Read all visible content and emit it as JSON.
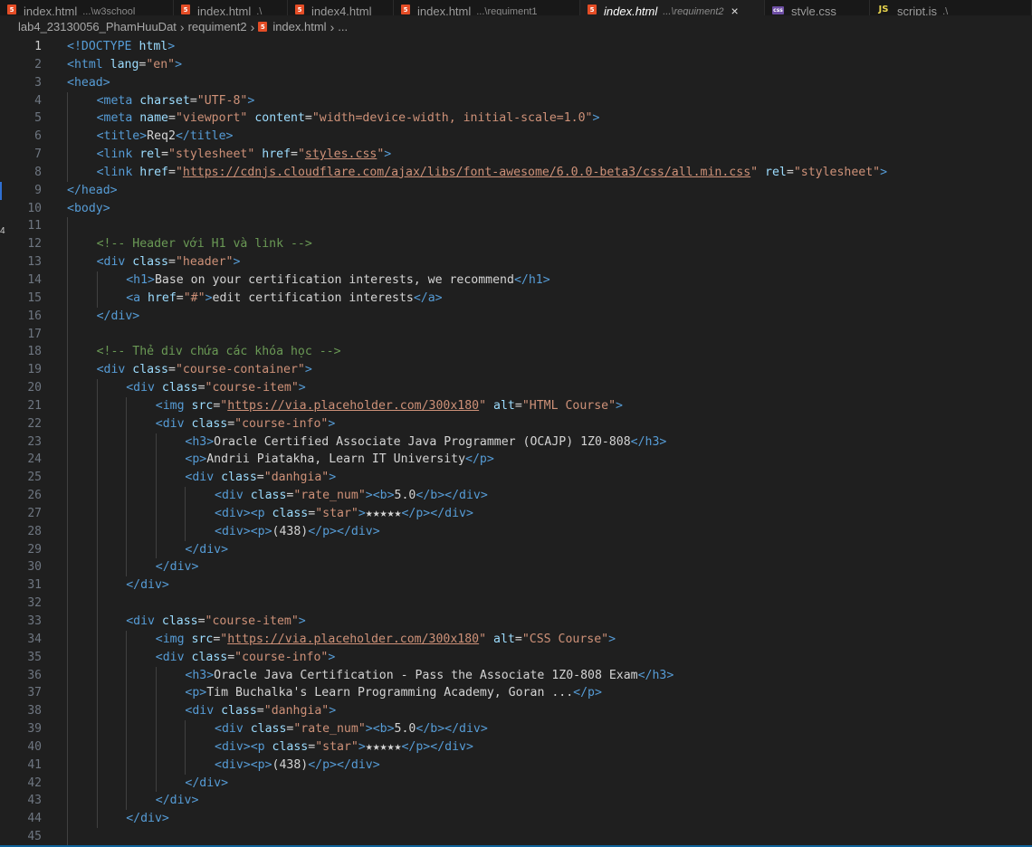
{
  "tabs": [
    {
      "name": "index.html",
      "desc": "...\\w3school",
      "type": "html",
      "active": false,
      "w": 192
    },
    {
      "name": "index.html",
      "desc": ".\\",
      "type": "html",
      "active": false,
      "w": 126
    },
    {
      "name": "index4.html",
      "desc": "",
      "type": "html",
      "active": false,
      "w": 117
    },
    {
      "name": "index.html",
      "desc": "...\\requiment1",
      "type": "html",
      "active": false,
      "w": 206
    },
    {
      "name": "index.html",
      "desc": "...\\requiment2",
      "type": "html",
      "active": true,
      "w": 204
    },
    {
      "name": "style.css",
      "desc": "",
      "type": "css",
      "active": false,
      "w": 116
    },
    {
      "name": "script.js",
      "desc": ".\\",
      "type": "js",
      "active": false,
      "w": 179
    }
  ],
  "breadcrumb": {
    "folder": "lab4_23130056_PhamHuuDat",
    "subfolder": "requiment2",
    "file": "index.html",
    "more": "..."
  },
  "editor": {
    "current_line": 1,
    "lines": [
      {
        "n": "1",
        "indent": 0,
        "tokens": [
          [
            "t",
            "<"
          ],
          [
            "d",
            "!DOCTYPE"
          ],
          [
            "x",
            " "
          ],
          [
            "a",
            "html"
          ],
          [
            "t",
            ">"
          ]
        ]
      },
      {
        "n": "2",
        "indent": 0,
        "tokens": [
          [
            "t",
            "<html "
          ],
          [
            "a",
            "lang"
          ],
          [
            "x",
            "="
          ],
          [
            "s",
            "\"en\""
          ],
          [
            "t",
            ">"
          ]
        ]
      },
      {
        "n": "3",
        "indent": 0,
        "tokens": [
          [
            "t",
            "<head>"
          ]
        ]
      },
      {
        "n": "4",
        "indent": 1,
        "tokens": [
          [
            "t",
            "<meta "
          ],
          [
            "a",
            "charset"
          ],
          [
            "x",
            "="
          ],
          [
            "s",
            "\"UTF-8\""
          ],
          [
            "t",
            ">"
          ]
        ]
      },
      {
        "n": "5",
        "indent": 1,
        "tokens": [
          [
            "t",
            "<meta "
          ],
          [
            "a",
            "name"
          ],
          [
            "x",
            "="
          ],
          [
            "s",
            "\"viewport\""
          ],
          [
            "x",
            " "
          ],
          [
            "a",
            "content"
          ],
          [
            "x",
            "="
          ],
          [
            "s",
            "\"width=device-width, initial-scale=1.0\""
          ],
          [
            "t",
            ">"
          ]
        ]
      },
      {
        "n": "6",
        "indent": 1,
        "tokens": [
          [
            "t",
            "<title>"
          ],
          [
            "x",
            "Req2"
          ],
          [
            "t",
            "</title>"
          ]
        ]
      },
      {
        "n": "7",
        "indent": 1,
        "tokens": [
          [
            "t",
            "<link "
          ],
          [
            "a",
            "rel"
          ],
          [
            "x",
            "="
          ],
          [
            "s",
            "\"stylesheet\""
          ],
          [
            "x",
            " "
          ],
          [
            "a",
            "href"
          ],
          [
            "x",
            "="
          ],
          [
            "s",
            "\""
          ],
          [
            "u",
            "styles.css"
          ],
          [
            "s",
            "\""
          ],
          [
            "t",
            ">"
          ]
        ]
      },
      {
        "n": "8",
        "indent": 1,
        "tokens": [
          [
            "t",
            "<link "
          ],
          [
            "a",
            "href"
          ],
          [
            "x",
            "="
          ],
          [
            "s",
            "\""
          ],
          [
            "u",
            "https://cdnjs.cloudflare.com/ajax/libs/font-awesome/6.0.0-beta3/css/all.min.css"
          ],
          [
            "s",
            "\""
          ],
          [
            "x",
            " "
          ],
          [
            "a",
            "rel"
          ],
          [
            "x",
            "="
          ],
          [
            "s",
            "\"stylesheet\""
          ],
          [
            "t",
            ">"
          ]
        ]
      },
      {
        "n": "9",
        "indent": 0,
        "tokens": [
          [
            "t",
            "</head>"
          ]
        ]
      },
      {
        "n": "10",
        "indent": 0,
        "tokens": [
          [
            "t",
            "<body>"
          ]
        ]
      },
      {
        "n": "11",
        "indent": 1,
        "tokens": []
      },
      {
        "n": "12",
        "indent": 1,
        "tokens": [
          [
            "c",
            "<!-- Header với H1 và link -->"
          ]
        ]
      },
      {
        "n": "13",
        "indent": 1,
        "tokens": [
          [
            "t",
            "<div "
          ],
          [
            "a",
            "class"
          ],
          [
            "x",
            "="
          ],
          [
            "s",
            "\"header\""
          ],
          [
            "t",
            ">"
          ]
        ]
      },
      {
        "n": "14",
        "indent": 2,
        "tokens": [
          [
            "t",
            "<h1>"
          ],
          [
            "x",
            "Base on your certification interests, we recommend"
          ],
          [
            "t",
            "</h1>"
          ]
        ]
      },
      {
        "n": "15",
        "indent": 2,
        "tokens": [
          [
            "t",
            "<a "
          ],
          [
            "a",
            "href"
          ],
          [
            "x",
            "="
          ],
          [
            "s",
            "\"#\""
          ],
          [
            "t",
            ">"
          ],
          [
            "x",
            "edit certification interests"
          ],
          [
            "t",
            "</a>"
          ]
        ]
      },
      {
        "n": "16",
        "indent": 1,
        "tokens": [
          [
            "t",
            "</div>"
          ]
        ]
      },
      {
        "n": "17",
        "indent": 1,
        "tokens": []
      },
      {
        "n": "18",
        "indent": 1,
        "tokens": [
          [
            "c",
            "<!-- Thẻ div chứa các khóa học -->"
          ]
        ]
      },
      {
        "n": "19",
        "indent": 1,
        "tokens": [
          [
            "t",
            "<div "
          ],
          [
            "a",
            "class"
          ],
          [
            "x",
            "="
          ],
          [
            "s",
            "\"course-container\""
          ],
          [
            "t",
            ">"
          ]
        ]
      },
      {
        "n": "20",
        "indent": 2,
        "tokens": [
          [
            "t",
            "<div "
          ],
          [
            "a",
            "class"
          ],
          [
            "x",
            "="
          ],
          [
            "s",
            "\"course-item\""
          ],
          [
            "t",
            ">"
          ]
        ]
      },
      {
        "n": "21",
        "indent": 3,
        "tokens": [
          [
            "t",
            "<img "
          ],
          [
            "a",
            "src"
          ],
          [
            "x",
            "="
          ],
          [
            "s",
            "\""
          ],
          [
            "u",
            "https://via.placeholder.com/300x180"
          ],
          [
            "s",
            "\""
          ],
          [
            "x",
            " "
          ],
          [
            "a",
            "alt"
          ],
          [
            "x",
            "="
          ],
          [
            "s",
            "\"HTML Course\""
          ],
          [
            "t",
            ">"
          ]
        ]
      },
      {
        "n": "22",
        "indent": 3,
        "tokens": [
          [
            "t",
            "<div "
          ],
          [
            "a",
            "class"
          ],
          [
            "x",
            "="
          ],
          [
            "s",
            "\"course-info\""
          ],
          [
            "t",
            ">"
          ]
        ]
      },
      {
        "n": "23",
        "indent": 4,
        "tokens": [
          [
            "t",
            "<h3>"
          ],
          [
            "x",
            "Oracle Certified Associate Java Programmer (OCAJP) 1Z0-808"
          ],
          [
            "t",
            "</h3>"
          ]
        ]
      },
      {
        "n": "24",
        "indent": 4,
        "tokens": [
          [
            "t",
            "<p>"
          ],
          [
            "x",
            "Andrii Piatakha, Learn IT University"
          ],
          [
            "t",
            "</p>"
          ]
        ]
      },
      {
        "n": "25",
        "indent": 4,
        "tokens": [
          [
            "t",
            "<div "
          ],
          [
            "a",
            "class"
          ],
          [
            "x",
            "="
          ],
          [
            "s",
            "\"danhgia\""
          ],
          [
            "t",
            ">"
          ]
        ]
      },
      {
        "n": "26",
        "indent": 5,
        "tokens": [
          [
            "t",
            "<div "
          ],
          [
            "a",
            "class"
          ],
          [
            "x",
            "="
          ],
          [
            "s",
            "\"rate_num\""
          ],
          [
            "t",
            ">"
          ],
          [
            "t",
            "<b>"
          ],
          [
            "x",
            "5.0"
          ],
          [
            "t",
            "</b>"
          ],
          [
            "t",
            "</div>"
          ]
        ]
      },
      {
        "n": "27",
        "indent": 5,
        "tokens": [
          [
            "t",
            "<div>"
          ],
          [
            "t",
            "<p "
          ],
          [
            "a",
            "class"
          ],
          [
            "x",
            "="
          ],
          [
            "s",
            "\"star\""
          ],
          [
            "t",
            ">"
          ],
          [
            "x",
            "★★★★★"
          ],
          [
            "t",
            "</p>"
          ],
          [
            "t",
            "</div>"
          ]
        ]
      },
      {
        "n": "28",
        "indent": 5,
        "tokens": [
          [
            "t",
            "<div>"
          ],
          [
            "t",
            "<p>"
          ],
          [
            "x",
            "(438)"
          ],
          [
            "t",
            "</p>"
          ],
          [
            "t",
            "</div>"
          ]
        ]
      },
      {
        "n": "29",
        "indent": 4,
        "tokens": [
          [
            "t",
            "</div>"
          ]
        ]
      },
      {
        "n": "30",
        "indent": 3,
        "tokens": [
          [
            "t",
            "</div>"
          ]
        ]
      },
      {
        "n": "31",
        "indent": 2,
        "tokens": [
          [
            "t",
            "</div>"
          ]
        ]
      },
      {
        "n": "32",
        "indent": 2,
        "tokens": []
      },
      {
        "n": "33",
        "indent": 2,
        "tokens": [
          [
            "t",
            "<div "
          ],
          [
            "a",
            "class"
          ],
          [
            "x",
            "="
          ],
          [
            "s",
            "\"course-item\""
          ],
          [
            "t",
            ">"
          ]
        ]
      },
      {
        "n": "34",
        "indent": 3,
        "tokens": [
          [
            "t",
            "<img "
          ],
          [
            "a",
            "src"
          ],
          [
            "x",
            "="
          ],
          [
            "s",
            "\""
          ],
          [
            "u",
            "https://via.placeholder.com/300x180"
          ],
          [
            "s",
            "\""
          ],
          [
            "x",
            " "
          ],
          [
            "a",
            "alt"
          ],
          [
            "x",
            "="
          ],
          [
            "s",
            "\"CSS Course\""
          ],
          [
            "t",
            ">"
          ]
        ]
      },
      {
        "n": "35",
        "indent": 3,
        "tokens": [
          [
            "t",
            "<div "
          ],
          [
            "a",
            "class"
          ],
          [
            "x",
            "="
          ],
          [
            "s",
            "\"course-info\""
          ],
          [
            "t",
            ">"
          ]
        ]
      },
      {
        "n": "36",
        "indent": 4,
        "tokens": [
          [
            "t",
            "<h3>"
          ],
          [
            "x",
            "Oracle Java Certification - Pass the Associate 1Z0-808 Exam"
          ],
          [
            "t",
            "</h3>"
          ]
        ]
      },
      {
        "n": "37",
        "indent": 4,
        "tokens": [
          [
            "t",
            "<p>"
          ],
          [
            "x",
            "Tim Buchalka's Learn Programming Academy, Goran ..."
          ],
          [
            "t",
            "</p>"
          ]
        ]
      },
      {
        "n": "38",
        "indent": 4,
        "tokens": [
          [
            "t",
            "<div "
          ],
          [
            "a",
            "class"
          ],
          [
            "x",
            "="
          ],
          [
            "s",
            "\"danhgia\""
          ],
          [
            "t",
            ">"
          ]
        ]
      },
      {
        "n": "39",
        "indent": 5,
        "tokens": [
          [
            "t",
            "<div "
          ],
          [
            "a",
            "class"
          ],
          [
            "x",
            "="
          ],
          [
            "s",
            "\"rate_num\""
          ],
          [
            "t",
            ">"
          ],
          [
            "t",
            "<b>"
          ],
          [
            "x",
            "5.0"
          ],
          [
            "t",
            "</b>"
          ],
          [
            "t",
            "</div>"
          ]
        ]
      },
      {
        "n": "40",
        "indent": 5,
        "tokens": [
          [
            "t",
            "<div>"
          ],
          [
            "t",
            "<p "
          ],
          [
            "a",
            "class"
          ],
          [
            "x",
            "="
          ],
          [
            "s",
            "\"star\""
          ],
          [
            "t",
            ">"
          ],
          [
            "x",
            "★★★★★"
          ],
          [
            "t",
            "</p>"
          ],
          [
            "t",
            "</div>"
          ]
        ]
      },
      {
        "n": "41",
        "indent": 5,
        "tokens": [
          [
            "t",
            "<div>"
          ],
          [
            "t",
            "<p>"
          ],
          [
            "x",
            "(438)"
          ],
          [
            "t",
            "</p>"
          ],
          [
            "t",
            "</div>"
          ]
        ]
      },
      {
        "n": "42",
        "indent": 4,
        "tokens": [
          [
            "t",
            "</div>"
          ]
        ]
      },
      {
        "n": "43",
        "indent": 3,
        "tokens": [
          [
            "t",
            "</div>"
          ]
        ]
      },
      {
        "n": "44",
        "indent": 2,
        "tokens": [
          [
            "t",
            "</div>"
          ]
        ]
      },
      {
        "n": "45",
        "indent": 1,
        "tokens": []
      }
    ]
  },
  "colors": {
    "tag": "#569cd6",
    "attr": "#9cdcfe",
    "string": "#ce9178",
    "comment": "#6a9955",
    "text": "#d4d4d4",
    "background": "#1f1f1f"
  }
}
